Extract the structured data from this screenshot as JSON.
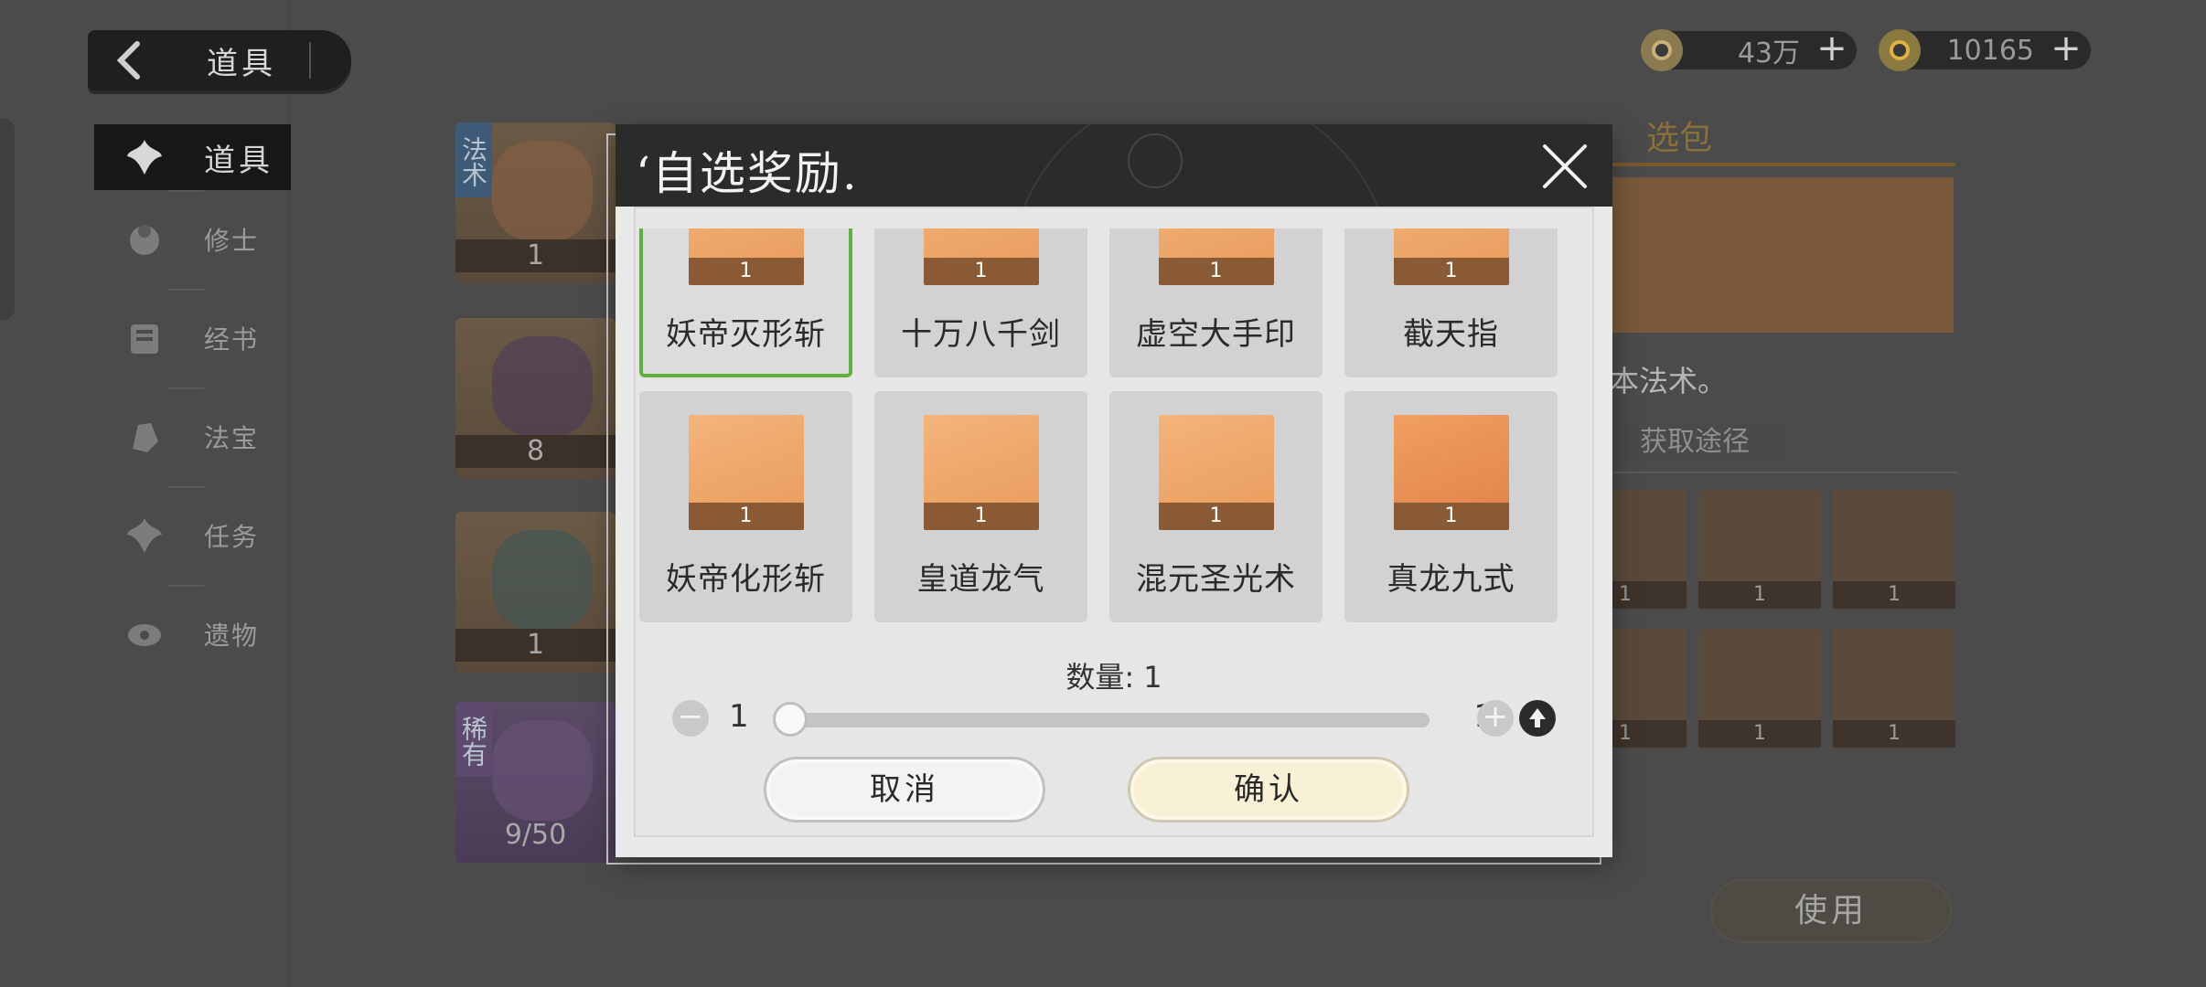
{
  "header": {
    "back_title": "道具",
    "currencies": [
      {
        "amount": "43万",
        "icon": "coin-icon"
      },
      {
        "amount": "10165",
        "icon": "token-icon"
      }
    ]
  },
  "sidebar": {
    "items": [
      {
        "label": "道具",
        "active": true,
        "icon": "flower-icon"
      },
      {
        "label": "修士",
        "active": false,
        "icon": "cultivator-icon"
      },
      {
        "label": "经书",
        "active": false,
        "icon": "scroll-icon"
      },
      {
        "label": "法宝",
        "active": false,
        "icon": "treasure-icon"
      },
      {
        "label": "任务",
        "active": false,
        "icon": "task-icon"
      },
      {
        "label": "遗物",
        "active": false,
        "icon": "relic-icon"
      }
    ]
  },
  "inventory": {
    "cards": [
      {
        "count": "1",
        "tag": "法术"
      },
      {
        "count": "8",
        "tag": ""
      },
      {
        "count": "1",
        "tag": ""
      },
      {
        "count": "9/50",
        "tag": "稀有"
      }
    ]
  },
  "detail_panel": {
    "title_fragment": "选包",
    "desc_fragment": "本法术。",
    "get_path_label": "获取途径",
    "mini_counts": [
      "1",
      "1",
      "1",
      "1",
      "1",
      "1"
    ],
    "use_label": "使用"
  },
  "modal": {
    "title": "‘自选奖励.",
    "rewards": [
      {
        "name": "妖帝灭形斩",
        "count": "1",
        "selected": true
      },
      {
        "name": "十万八千剑",
        "count": "1",
        "selected": false
      },
      {
        "name": "虚空大手印",
        "count": "1",
        "selected": false
      },
      {
        "name": "截天指",
        "count": "1",
        "selected": false
      },
      {
        "name": "妖帝化形斩",
        "count": "1",
        "selected": false
      },
      {
        "name": "皇道龙气",
        "count": "1",
        "selected": false
      },
      {
        "name": "混元圣光术",
        "count": "1",
        "selected": false
      },
      {
        "name": "真龙九式",
        "count": "1",
        "selected": false
      }
    ],
    "quantity_label": "数量: 1",
    "quantity_min": "1",
    "quantity_max": "1",
    "quantity_value": 1,
    "cancel_label": "取消",
    "confirm_label": "确认"
  },
  "colors": {
    "selected_border": "#5fb33a",
    "confirm_bg": "#f8f1d6",
    "header_bg": "#2b2b2b"
  }
}
